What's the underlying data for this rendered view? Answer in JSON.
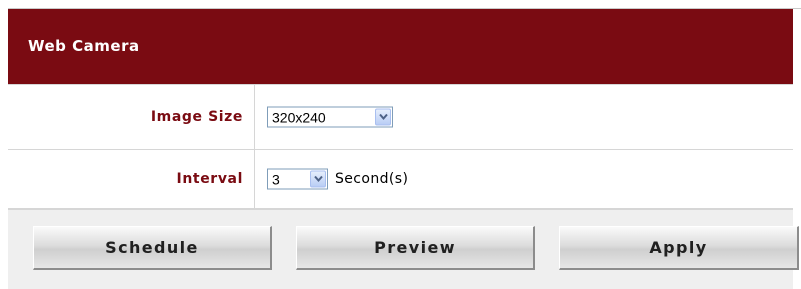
{
  "header": {
    "title": "Web Camera"
  },
  "form": {
    "image_size": {
      "label": "Image Size",
      "value": "320x240"
    },
    "interval": {
      "label": "Interval",
      "value": "3",
      "unit": "Second(s)"
    }
  },
  "buttons": {
    "schedule": "Schedule",
    "preview": "Preview",
    "apply": "Apply"
  },
  "colors": {
    "header_bg": "#7a0b12",
    "label_text": "#7a0b12",
    "button_bar_bg": "#efefef"
  },
  "icons": {
    "dropdown": "chevron-down-icon"
  }
}
